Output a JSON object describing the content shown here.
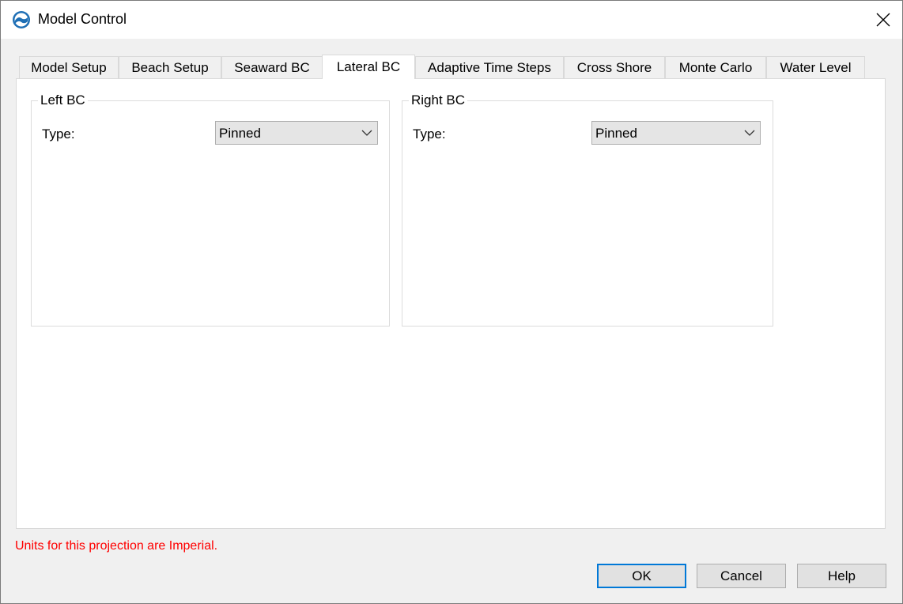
{
  "window": {
    "title": "Model Control"
  },
  "tabs": [
    {
      "label": "Model Setup"
    },
    {
      "label": "Beach Setup"
    },
    {
      "label": "Seaward BC"
    },
    {
      "label": "Lateral BC"
    },
    {
      "label": "Adaptive Time Steps"
    },
    {
      "label": "Cross Shore"
    },
    {
      "label": "Monte Carlo"
    },
    {
      "label": "Water Level"
    }
  ],
  "active_tab": "Lateral BC",
  "left_bc": {
    "title": "Left BC",
    "type_label": "Type:",
    "type_value": "Pinned"
  },
  "right_bc": {
    "title": "Right BC",
    "type_label": "Type:",
    "type_value": "Pinned"
  },
  "status": {
    "units_note": "Units for this projection are Imperial.",
    "color": "#ff0000"
  },
  "buttons": {
    "ok": "OK",
    "cancel": "Cancel",
    "help": "Help"
  },
  "icons": {
    "app": "model-control-logo-icon",
    "close": "close-icon",
    "dropdown": "chevron-down-icon"
  },
  "colors": {
    "accent": "#0078d7",
    "app_icon": "#1f6fb5"
  }
}
